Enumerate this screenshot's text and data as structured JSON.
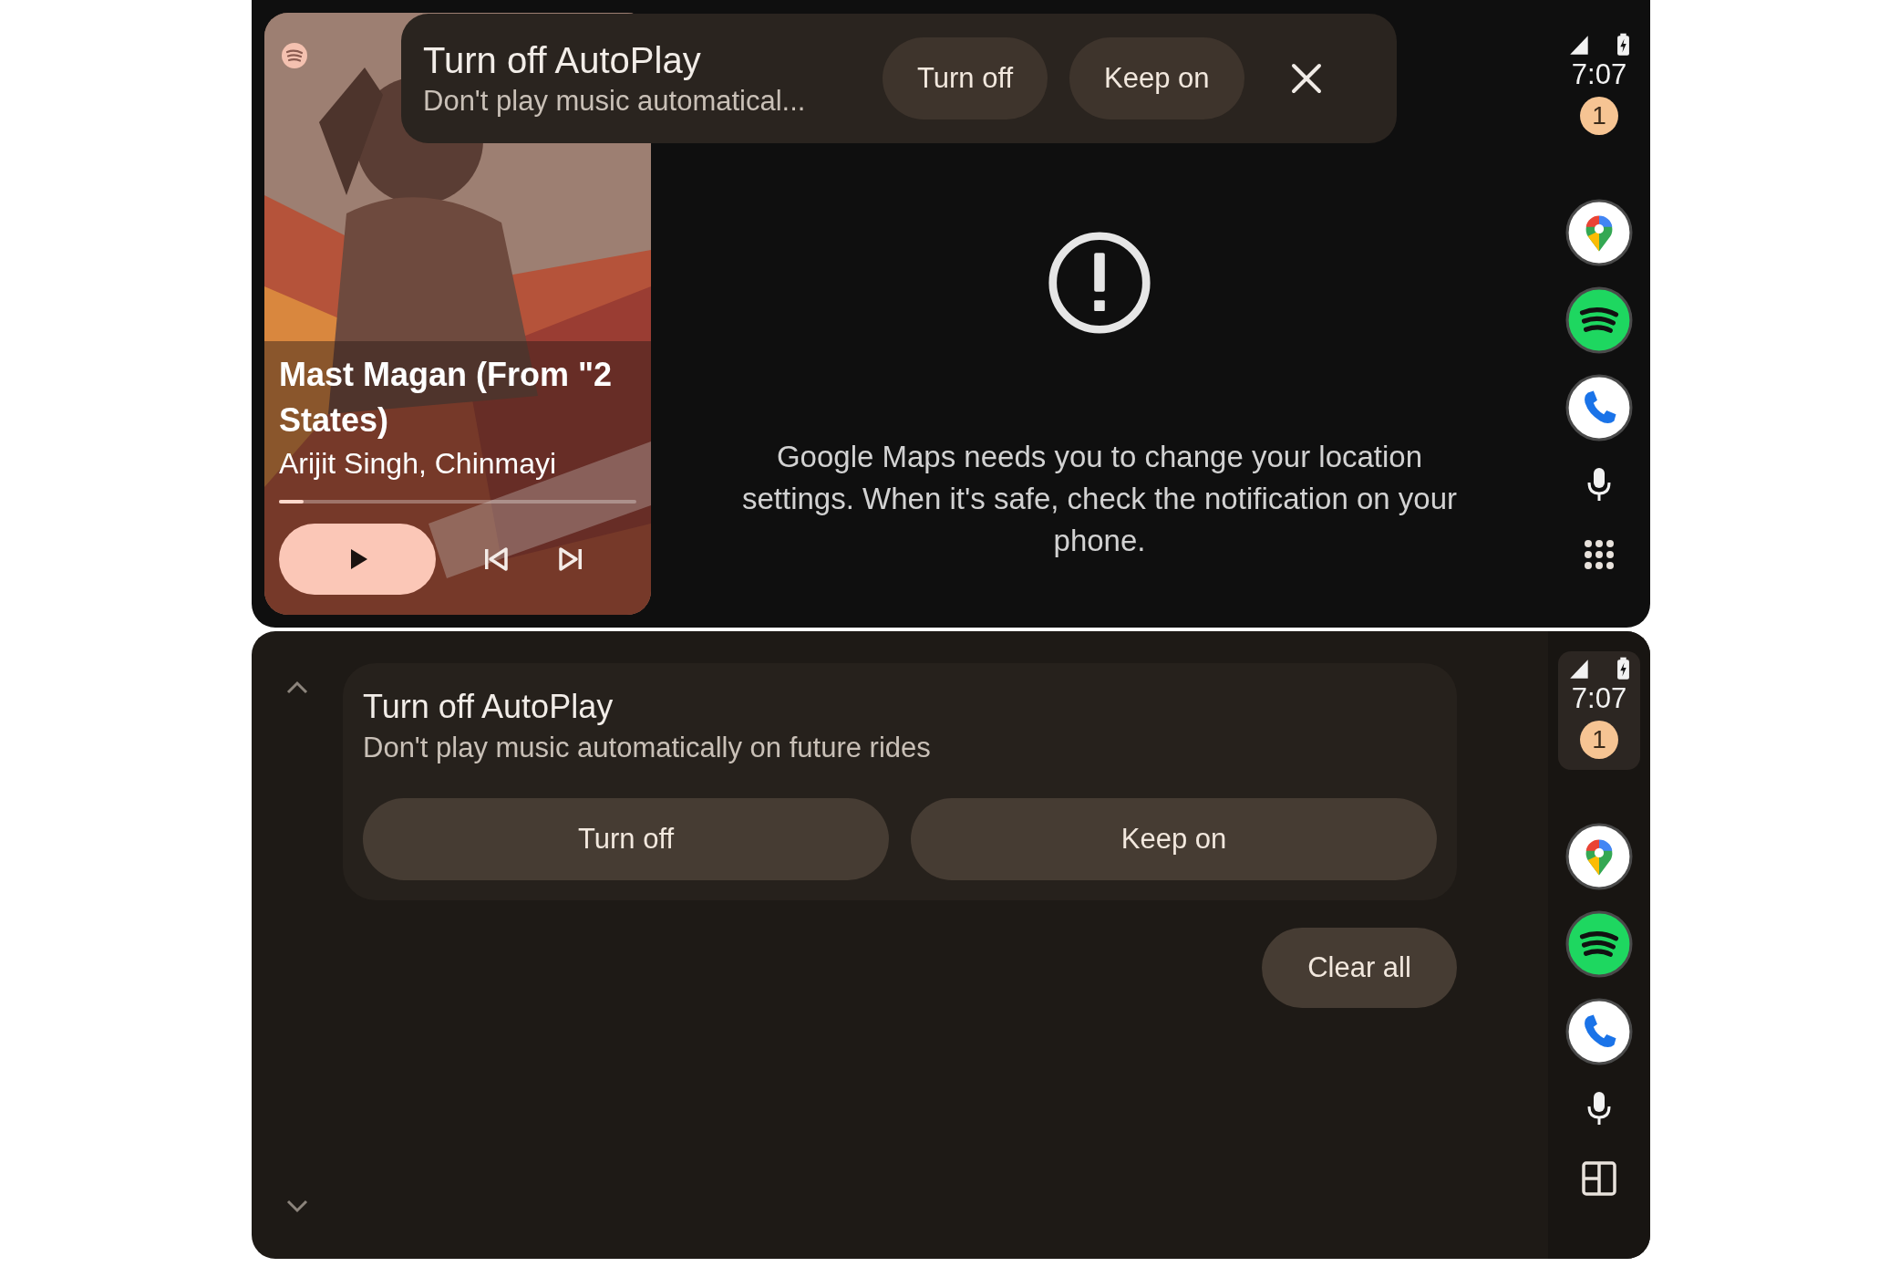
{
  "top_screen": {
    "media": {
      "title": "Mast Magan (From \"2 States)",
      "artist": "Arijit Singh, Chinmayi",
      "level": 0.07,
      "playing": false
    },
    "banner": {
      "title": "Turn off AutoPlay",
      "subtitle": "Don't play music automatical...",
      "buttons": [
        "Turn off",
        "Keep on"
      ]
    },
    "alert": {
      "message": "Google Maps needs you to change your location settings. When it's safe, check the notification on your phone."
    },
    "rail": {
      "time": "7:07",
      "badge": "1",
      "status_selected": false,
      "apps": [
        {
          "kind": "maps"
        },
        {
          "kind": "spotify"
        },
        {
          "kind": "phone"
        }
      ],
      "launcher": {
        "kind": "grid"
      }
    }
  },
  "bottom_screen": {
    "notification": {
      "title": "Turn off AutoPlay",
      "subtitle": "Don't play music automatically on future rides",
      "buttons": [
        "Turn off",
        "Keep on"
      ]
    },
    "clear_all": "Clear all",
    "rail": {
      "time": "7:07",
      "badge": "1",
      "status_selected": true,
      "apps": [
        {
          "kind": "maps"
        },
        {
          "kind": "spotify"
        },
        {
          "kind": "phone"
        }
      ],
      "launcher": {
        "kind": "split"
      }
    }
  }
}
